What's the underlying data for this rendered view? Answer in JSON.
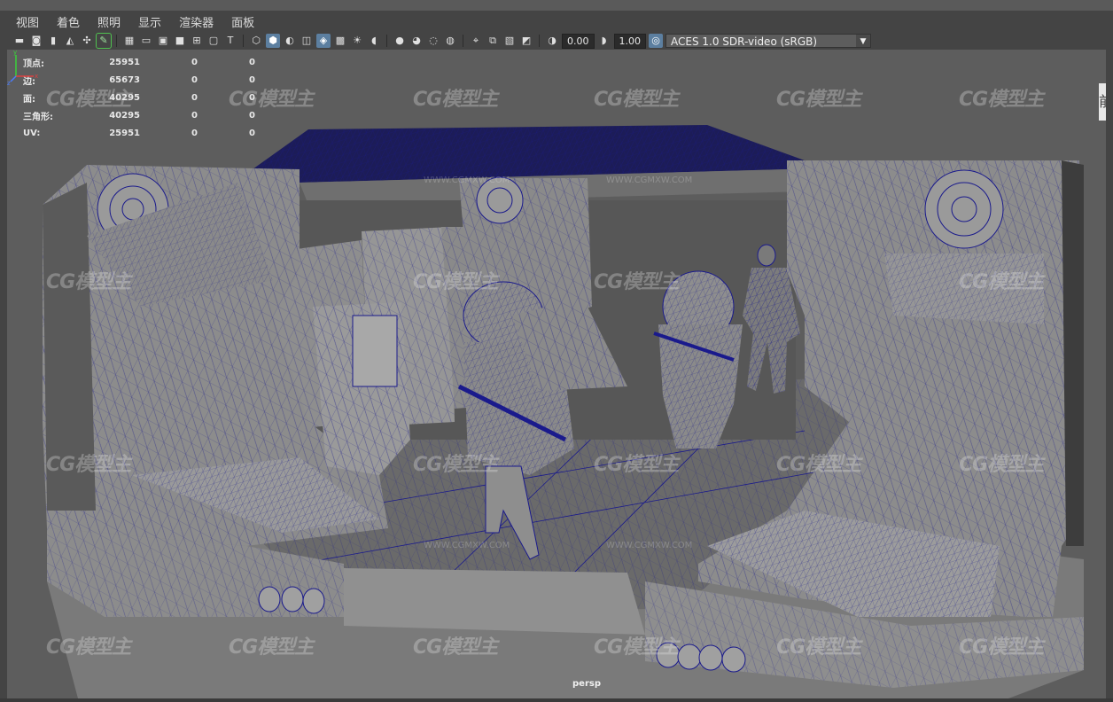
{
  "menu": [
    "视图",
    "着色",
    "照明",
    "显示",
    "渲染器",
    "面板"
  ],
  "toolbar": {
    "exposure_value": "0.00",
    "gamma_value": "1.00",
    "colorspace": "ACES 1.0 SDR-video (sRGB)",
    "icons": [
      "camera-select-icon",
      "camera-attributes-icon",
      "bookmark-icon",
      "image-plane-icon",
      "grease-pencil-icon",
      "grid-icon",
      "film-gate-icon",
      "resolution-gate-icon",
      "gate-mask-icon",
      "field-chart-icon",
      "safe-action-icon",
      "safe-title-icon",
      "wireframe-icon",
      "smooth-shade-icon",
      "shade-default-icon",
      "wireframe-on-shaded-icon",
      "xray-icon",
      "use-lights-icon",
      "shadows-icon",
      "screen-space-ao-icon",
      "motion-blur-icon",
      "anti-aliasing-icon",
      "depth-of-field-icon",
      "isolate-select-icon",
      "xray-joints-icon",
      "xray-active-icon",
      "xray-components-icon"
    ]
  },
  "hud": {
    "rows": [
      {
        "label": "顶点:",
        "value": "25951",
        "z1": "0",
        "z2": "0"
      },
      {
        "label": "边:",
        "value": "65673",
        "z1": "0",
        "z2": "0"
      },
      {
        "label": "面:",
        "value": "40295",
        "z1": "0",
        "z2": "0"
      },
      {
        "label": "三角形:",
        "value": "40295",
        "z1": "0",
        "z2": "0"
      },
      {
        "label": "UV:",
        "value": "25951",
        "z1": "0",
        "z2": "0"
      }
    ]
  },
  "camera_label": "persp",
  "right_tab": "前",
  "watermark": {
    "brand": "CG模型主",
    "url": "WWW.CGMXW.COM"
  },
  "colors": {
    "viewport_bg": "#5d5d5d",
    "wire": "#1a1a8c",
    "mesh": "#8a8a8a"
  }
}
